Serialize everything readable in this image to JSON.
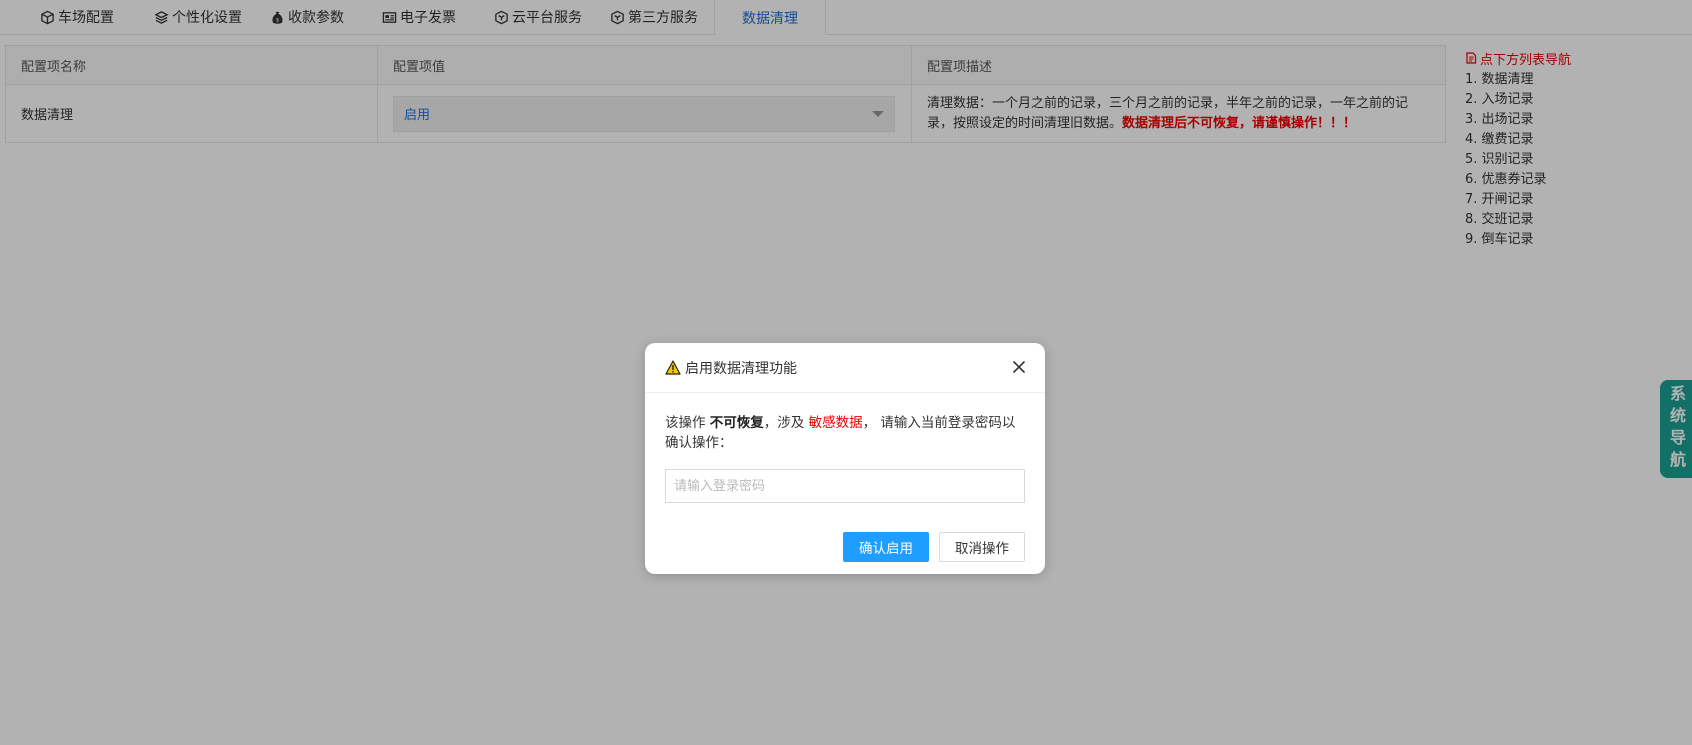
{
  "tabs": [
    {
      "label": "车场配置",
      "icon": "cube-icon"
    },
    {
      "label": "个性化设置",
      "icon": "layers-icon"
    },
    {
      "label": "收款参数",
      "icon": "money-bag-icon"
    },
    {
      "label": "电子发票",
      "icon": "invoice-icon"
    },
    {
      "label": "云平台服务",
      "icon": "cube-outline-icon"
    },
    {
      "label": "第三方服务",
      "icon": "cube-outline-icon"
    },
    {
      "label": "数据清理",
      "active": true
    }
  ],
  "table": {
    "headers": [
      "配置项名称",
      "配置项值",
      "配置项描述"
    ],
    "row": {
      "name": "数据清理",
      "value": "启用",
      "desc_normal": "清理数据：一个月之前的记录，三个月之前的记录，半年之前的记录，一年之前的记录，按照设定的时间清理旧数据。",
      "desc_warn": "数据清理后不可恢复，请谨慎操作！！！"
    }
  },
  "side_nav": {
    "head": "点下方列表导航",
    "items": [
      "1. 数据清理",
      "2. 入场记录",
      "3. 出场记录",
      "4. 缴费记录",
      "5. 识别记录",
      "6. 优惠券记录",
      "7. 开闸记录",
      "8. 交班记录",
      "9. 倒车记录"
    ]
  },
  "sys_nav_label": "系统导航",
  "dialog": {
    "title": "启用数据清理功能",
    "msg_prefix": "该操作 ",
    "msg_bold": "不可恢复",
    "msg_mid": "，涉及 ",
    "msg_red": "敏感数据",
    "msg_suffix": "， 请输入当前登录密码以确认操作：",
    "input_placeholder": "请输入登录密码",
    "confirm_label": "确认启用",
    "cancel_label": "取消操作"
  },
  "colors": {
    "accent": "#1e9fff",
    "tab_active": "#1e6fd9",
    "warn": "#e00000",
    "sys_nav_bg": "#1aa194"
  }
}
